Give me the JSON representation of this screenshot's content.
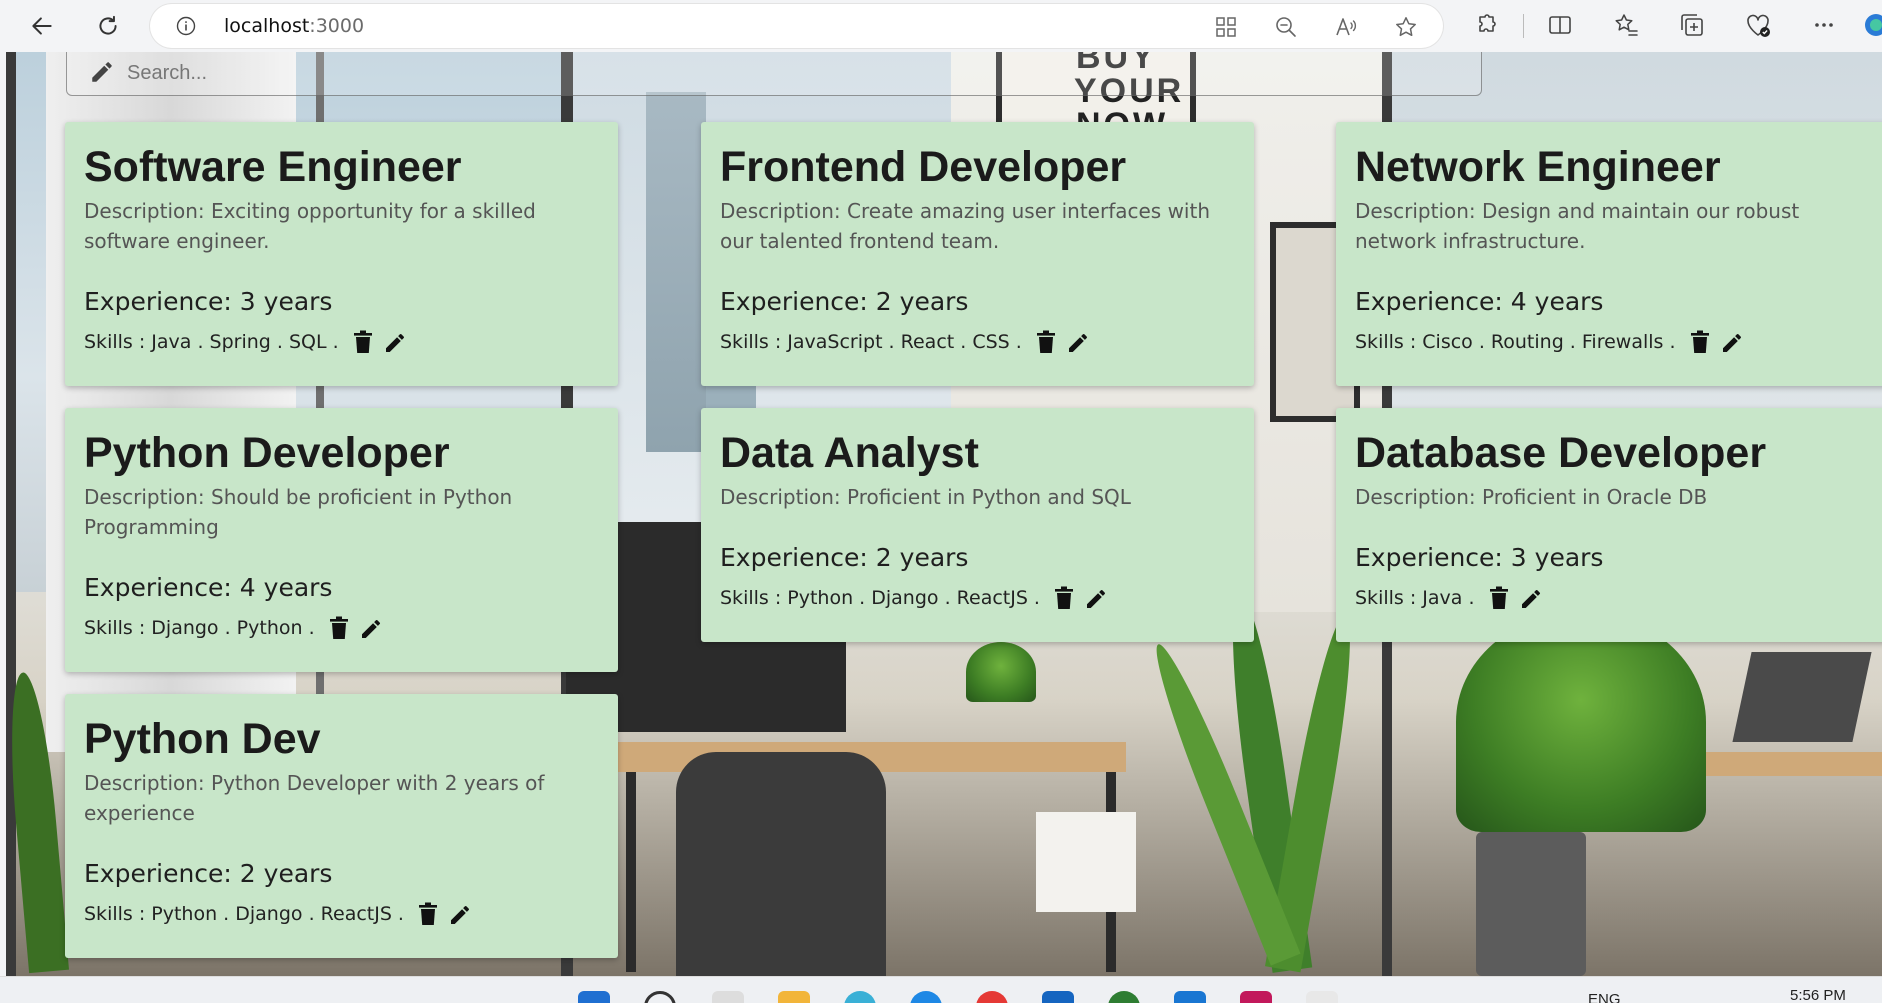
{
  "browser": {
    "url_host": "localhost",
    "url_port": ":3000"
  },
  "search": {
    "placeholder": "Search..."
  },
  "background": {
    "poster_line1": "BUY",
    "poster_line2": "YOUR",
    "poster_line3": "NOW"
  },
  "jobs": [
    {
      "title": "Software Engineer",
      "desc_label": "Description: ",
      "desc": "Exciting opportunity for a skilled software engineer.",
      "exp_label": "Experience: ",
      "exp": "3 years",
      "skills": "Skills : Java . Spring . SQL ."
    },
    {
      "title": "Frontend Developer",
      "desc_label": "Description: ",
      "desc": "Create amazing user interfaces with our talented frontend team.",
      "exp_label": "Experience: ",
      "exp": "2 years",
      "skills": "Skills : JavaScript . React . CSS ."
    },
    {
      "title": "Network Engineer",
      "desc_label": "Description: ",
      "desc": "Design and maintain our robust network infrastructure.",
      "exp_label": "Experience: ",
      "exp": "4 years",
      "skills": "Skills : Cisco . Routing . Firewalls ."
    },
    {
      "title": "Python Developer",
      "desc_label": "Description: ",
      "desc": "Should be proficient in Python Programming",
      "exp_label": "Experience: ",
      "exp": "4 years",
      "skills": "Skills : Django . Python ."
    },
    {
      "title": "Data Analyst",
      "desc_label": "Description: ",
      "desc": "Proficient in Python and SQL",
      "exp_label": "Experience: ",
      "exp": "2 years",
      "skills": "Skills : Python . Django . ReactJS ."
    },
    {
      "title": "Database Developer",
      "desc_label": "Description: ",
      "desc": "Proficient in Oracle DB",
      "exp_label": "Experience: ",
      "exp": "3 years",
      "skills": "Skills : Java ."
    },
    {
      "title": "Python Dev",
      "desc_label": "Description: ",
      "desc": "Python Developer with 2 years of experience",
      "exp_label": "Experience: ",
      "exp": "2 years",
      "skills": "Skills : Python . Django . ReactJS ."
    }
  ],
  "icons": {
    "delete": "trash-icon",
    "edit": "pencil-icon"
  },
  "colors": {
    "card_bg": "#c8e6c9",
    "title": "#1b1b1b",
    "desc": "#555555"
  },
  "taskbar": {
    "lang": "ENG",
    "time": "5:56 PM"
  }
}
